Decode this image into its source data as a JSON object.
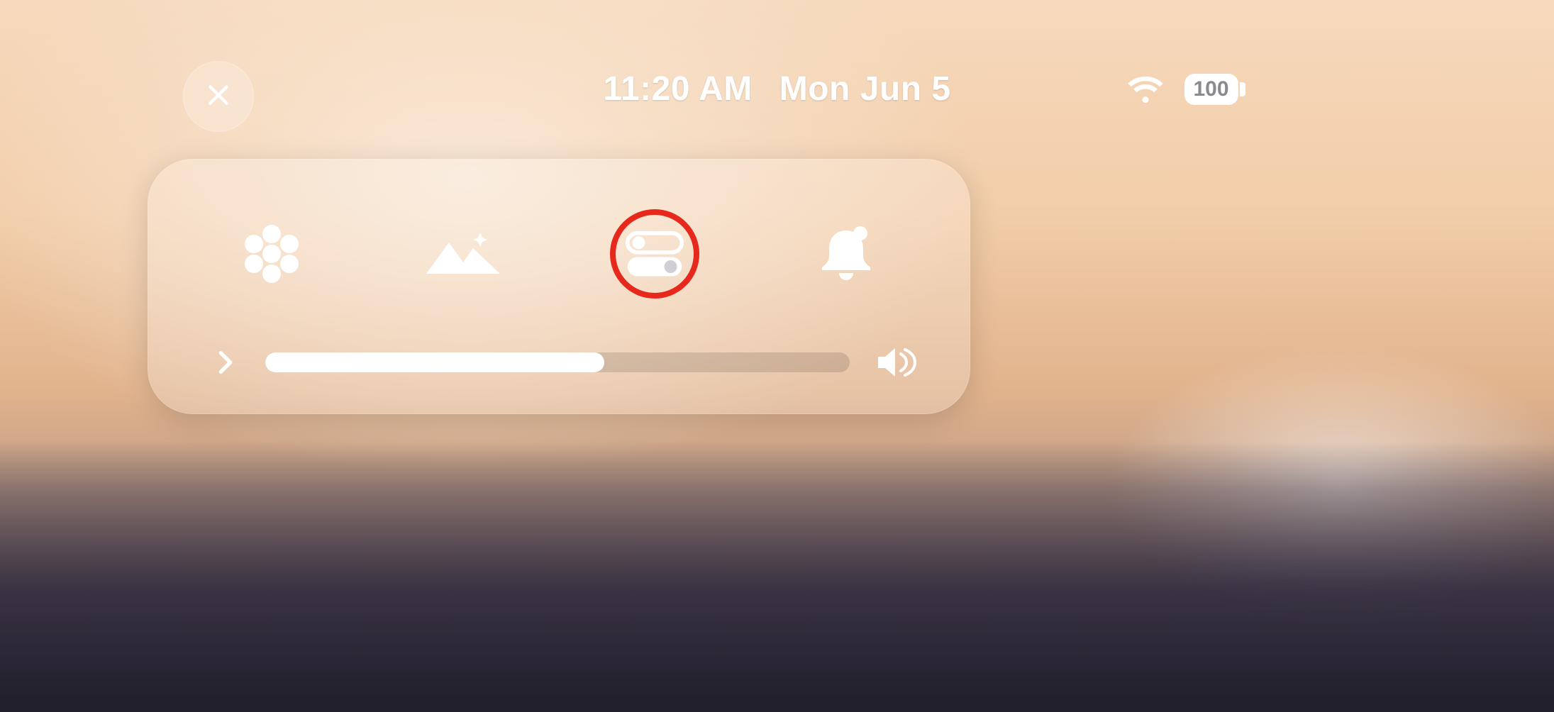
{
  "status": {
    "time": "11:20 AM",
    "date": "Mon Jun 5",
    "wifi_connected": true,
    "battery_percent": "100"
  },
  "close": {
    "name": "close"
  },
  "panel": {
    "buttons": [
      {
        "name": "apps"
      },
      {
        "name": "environments"
      },
      {
        "name": "control-center"
      },
      {
        "name": "notifications"
      }
    ],
    "volume": {
      "percent": 58
    }
  },
  "annotation": {
    "highlighted_button": "control-center",
    "color": "#e02a1f"
  }
}
